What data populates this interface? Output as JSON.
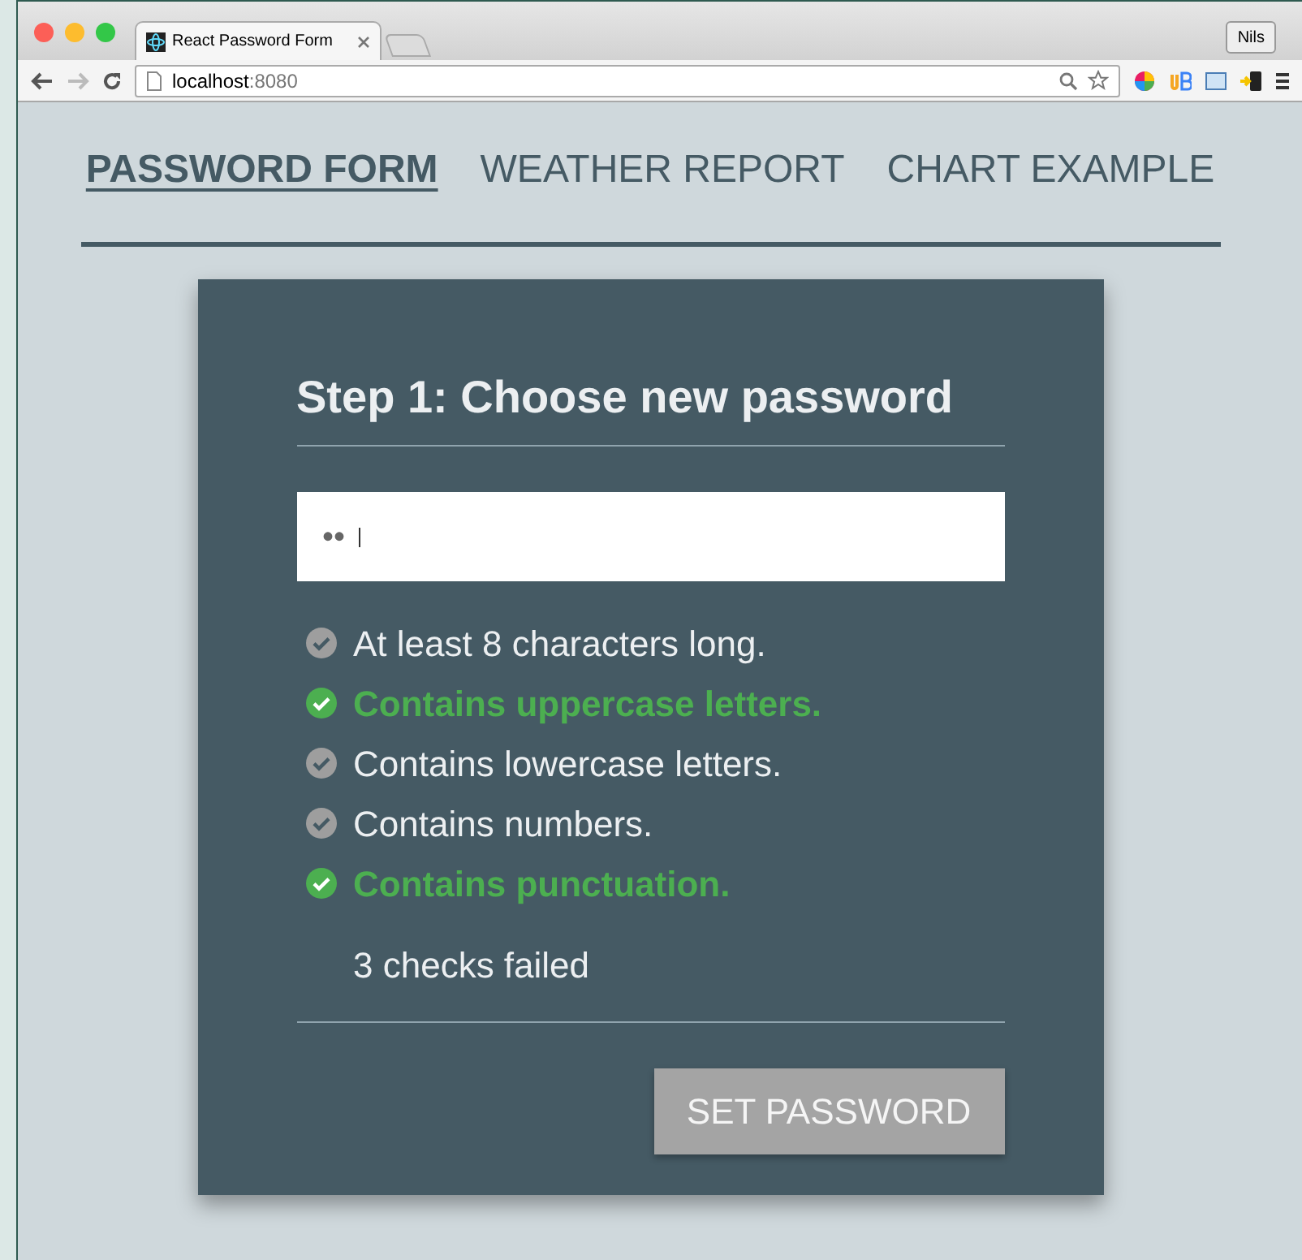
{
  "browser": {
    "tab_title": "React Password Form",
    "profile": "Nils",
    "address_host": "localhost",
    "address_port": ":8080"
  },
  "nav": [
    {
      "label": "PASSWORD FORM",
      "selected": true
    },
    {
      "label": "WEATHER REPORT",
      "selected": false
    },
    {
      "label": "CHART EXAMPLE",
      "selected": false
    }
  ],
  "form": {
    "title": "Step 1: Choose new password",
    "password_value": "••",
    "checks": [
      {
        "label": "At least 8 characters long.",
        "passed": false
      },
      {
        "label": "Contains uppercase letters.",
        "passed": true
      },
      {
        "label": "Contains lowercase letters.",
        "passed": false
      },
      {
        "label": "Contains numbers.",
        "passed": false
      },
      {
        "label": "Contains punctuation.",
        "passed": true
      }
    ],
    "summary": "3 checks failed",
    "button": {
      "label": "SET PASSWORD",
      "disabled": true
    }
  }
}
